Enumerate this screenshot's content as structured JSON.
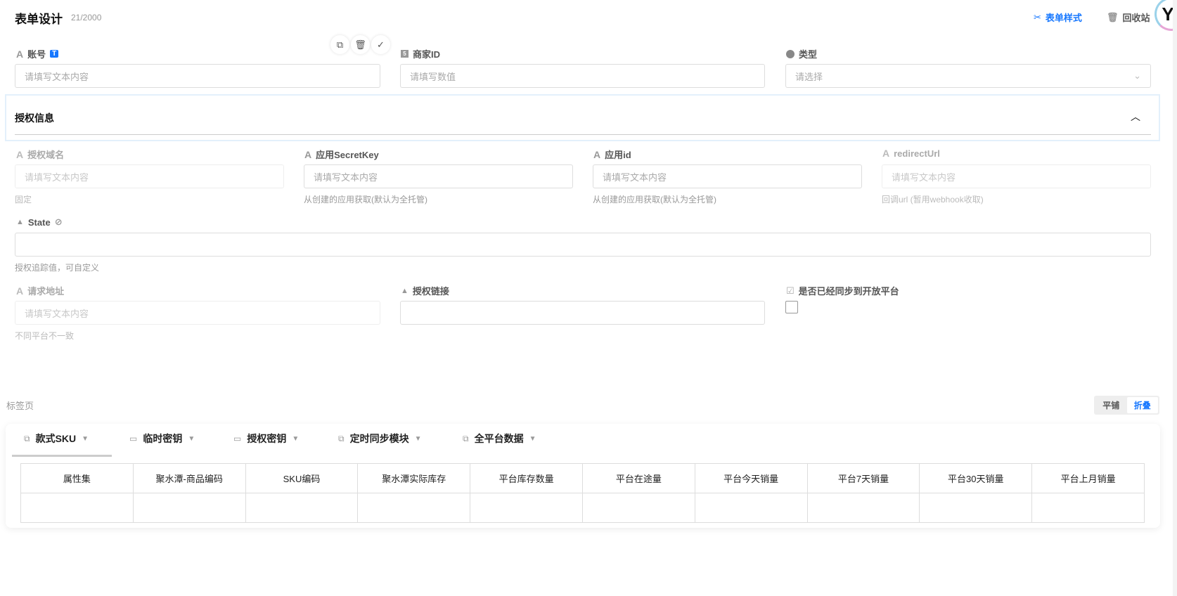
{
  "header": {
    "title": "表单设计",
    "count": "21/2000",
    "form_style": "表单样式",
    "recycle": "回收站",
    "avatar_glyph": "Y"
  },
  "row1": [
    {
      "label": "账号",
      "badge": "T",
      "placeholder": "请填写文本内容"
    },
    {
      "label": "商家ID",
      "placeholder": "请填写数值"
    },
    {
      "label": "类型",
      "placeholder": "请选择"
    }
  ],
  "section": {
    "title": "授权信息"
  },
  "row2": [
    {
      "label": "授权域名",
      "placeholder": "请填写文本内容",
      "help": "固定"
    },
    {
      "label": "应用SecretKey",
      "placeholder": "请填写文本内容",
      "help": "从创建的应用获取(默认为全托管)"
    },
    {
      "label": "应用id",
      "placeholder": "请填写文本内容",
      "help": "从创建的应用获取(默认为全托管)"
    },
    {
      "label": "redirectUrl",
      "placeholder": "请填写文本内容",
      "help": "回调url (暂用webhook收取)"
    }
  ],
  "state": {
    "label": "State",
    "help": "授权追踪值，可自定义"
  },
  "row4": [
    {
      "label": "请求地址",
      "placeholder": "请填写文本内容",
      "help": "不同平台不一致"
    },
    {
      "label": "授权链接"
    },
    {
      "label": "是否已经同步到开放平台",
      "checked": false
    }
  ],
  "tabs_section": {
    "label": "标签页",
    "toggle": [
      "平铺",
      "折叠"
    ],
    "active_toggle": "折叠",
    "tabs": [
      "款式SKU",
      "临时密钥",
      "授权密钥",
      "定时同步模块",
      "全平台数据"
    ],
    "columns": [
      "属性集",
      "聚水潭-商品编码",
      "SKU编码",
      "聚水潭实际库存",
      "平台库存数量",
      "平台在途量",
      "平台今天销量",
      "平台7天销量",
      "平台30天销量",
      "平台上月销量"
    ]
  },
  "colors": {
    "accent": "#1677ff",
    "section_border": "#e3f0fb"
  }
}
